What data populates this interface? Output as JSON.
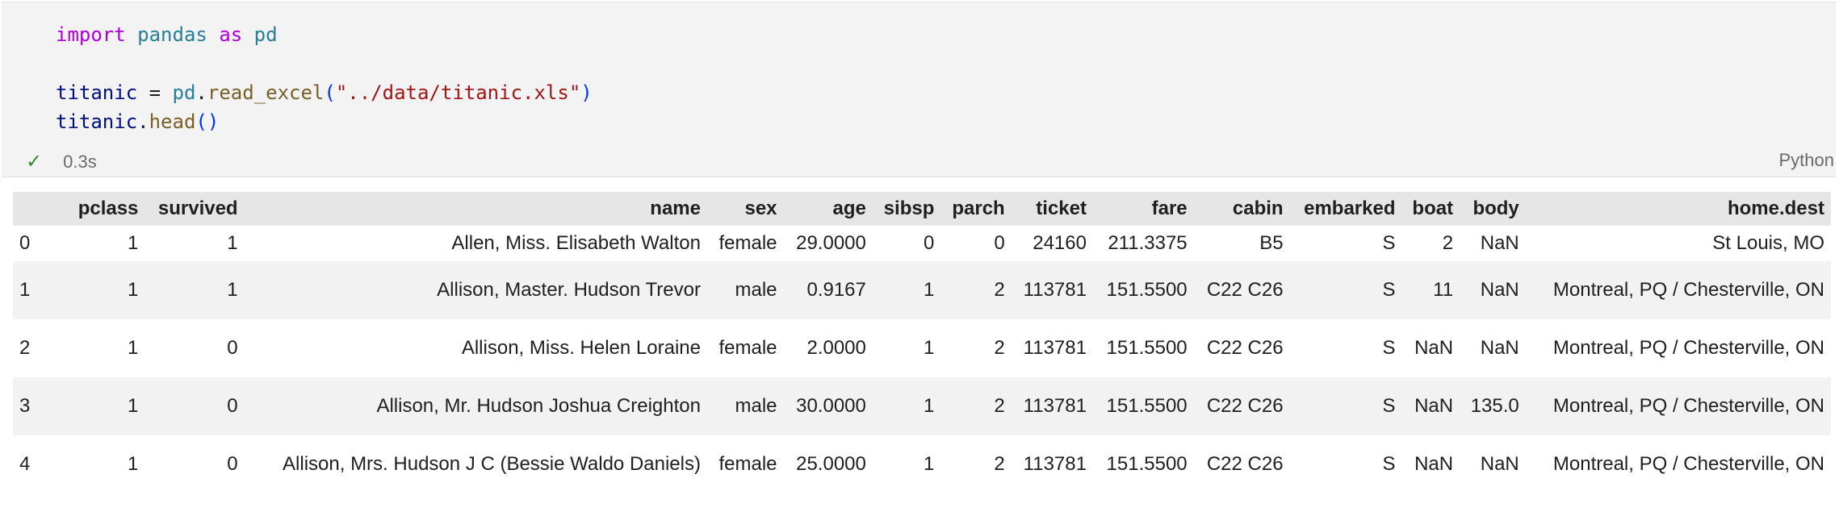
{
  "cell": {
    "code_lines": [
      [
        {
          "t": "import",
          "c": "kw"
        },
        {
          "t": " ",
          "c": "pun"
        },
        {
          "t": "pandas",
          "c": "mod"
        },
        {
          "t": " ",
          "c": "pun"
        },
        {
          "t": "as",
          "c": "kw"
        },
        {
          "t": " ",
          "c": "pun"
        },
        {
          "t": "pd",
          "c": "mod"
        }
      ],
      [],
      [
        {
          "t": "titanic",
          "c": "var"
        },
        {
          "t": " = ",
          "c": "pun"
        },
        {
          "t": "pd",
          "c": "mod"
        },
        {
          "t": ".",
          "c": "pun"
        },
        {
          "t": "read_excel",
          "c": "fn"
        },
        {
          "t": "(",
          "c": "bra"
        },
        {
          "t": "\"../data/titanic.xls\"",
          "c": "str"
        },
        {
          "t": ")",
          "c": "bra"
        }
      ],
      [
        {
          "t": "titanic",
          "c": "var"
        },
        {
          "t": ".",
          "c": "pun"
        },
        {
          "t": "head",
          "c": "fn"
        },
        {
          "t": "()",
          "c": "bra"
        }
      ]
    ],
    "exec_time": "0.3s",
    "language": "Python",
    "status_color": "#388a34"
  },
  "table": {
    "columns": [
      "",
      "pclass",
      "survived",
      "name",
      "sex",
      "age",
      "sibsp",
      "parch",
      "ticket",
      "fare",
      "cabin",
      "embarked",
      "boat",
      "body",
      "home.dest"
    ],
    "rows": [
      [
        "0",
        "1",
        "1",
        "Allen, Miss. Elisabeth Walton",
        "female",
        "29.0000",
        "0",
        "0",
        "24160",
        "211.3375",
        "B5",
        "S",
        "2",
        "NaN",
        "St Louis, MO"
      ],
      [
        "1",
        "1",
        "1",
        "Allison, Master. Hudson Trevor",
        "male",
        "0.9167",
        "1",
        "2",
        "113781",
        "151.5500",
        "C22 C26",
        "S",
        "11",
        "NaN",
        "Montreal, PQ / Chesterville, ON"
      ],
      [
        "2",
        "1",
        "0",
        "Allison, Miss. Helen Loraine",
        "female",
        "2.0000",
        "1",
        "2",
        "113781",
        "151.5500",
        "C22 C26",
        "S",
        "NaN",
        "NaN",
        "Montreal, PQ / Chesterville, ON"
      ],
      [
        "3",
        "1",
        "0",
        "Allison, Mr. Hudson Joshua Creighton",
        "male",
        "30.0000",
        "1",
        "2",
        "113781",
        "151.5500",
        "C22 C26",
        "S",
        "NaN",
        "135.0",
        "Montreal, PQ / Chesterville, ON"
      ],
      [
        "4",
        "1",
        "0",
        "Allison, Mrs. Hudson J C (Bessie Waldo Daniels)",
        "female",
        "25.0000",
        "1",
        "2",
        "113781",
        "151.5500",
        "C22 C26",
        "S",
        "NaN",
        "NaN",
        "Montreal, PQ / Chesterville, ON"
      ]
    ]
  }
}
